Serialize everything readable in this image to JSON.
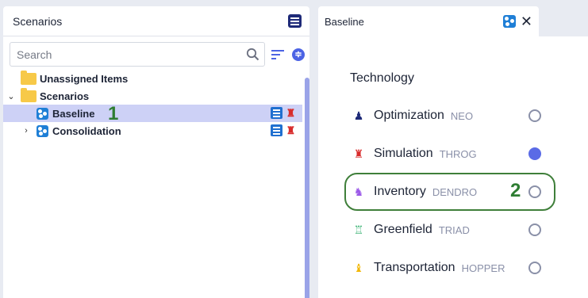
{
  "left_panel": {
    "title": "Scenarios",
    "search": {
      "placeholder": "Search",
      "value": ""
    },
    "sort_glyph": "≑",
    "tree": [
      {
        "label": "Unassigned Items",
        "type": "folder",
        "expanded": false
      },
      {
        "label": "Scenarios",
        "type": "folder",
        "expanded": true,
        "chevron": "⌄"
      },
      {
        "label": "Baseline",
        "type": "scenario",
        "selected": true,
        "step": "1"
      },
      {
        "label": "Consolidation",
        "type": "scenario",
        "chevron": "›"
      }
    ]
  },
  "right_panel": {
    "tab_title": "Baseline",
    "close_glyph": "✕",
    "section_title": "Technology",
    "technologies": [
      {
        "name": "Optimization",
        "code": "NEO",
        "icon": "optimization-neo-icon",
        "color": "#1e2a78",
        "glyph": "♟",
        "selected": false
      },
      {
        "name": "Simulation",
        "code": "THROG",
        "icon": "simulation-throg-icon",
        "color": "#d82c2c",
        "glyph": "♜",
        "selected": true
      },
      {
        "name": "Inventory",
        "code": "DENDRO",
        "icon": "inventory-dendro-icon",
        "color": "#9b59e8",
        "glyph": "♞",
        "selected": false
      },
      {
        "name": "Greenfield",
        "code": "TRIAD",
        "icon": "greenfield-triad-icon",
        "color": "#2fae6b",
        "glyph": "♖",
        "selected": false
      },
      {
        "name": "Transportation",
        "code": "HOPPER",
        "icon": "transportation-hopper-icon",
        "color": "#f2b705",
        "glyph": "♝",
        "selected": false
      }
    ],
    "step": "2"
  },
  "colors": {
    "accent": "#4c63e4",
    "selected_row": "#cdd1f6",
    "highlight": "#3f7f3a"
  }
}
